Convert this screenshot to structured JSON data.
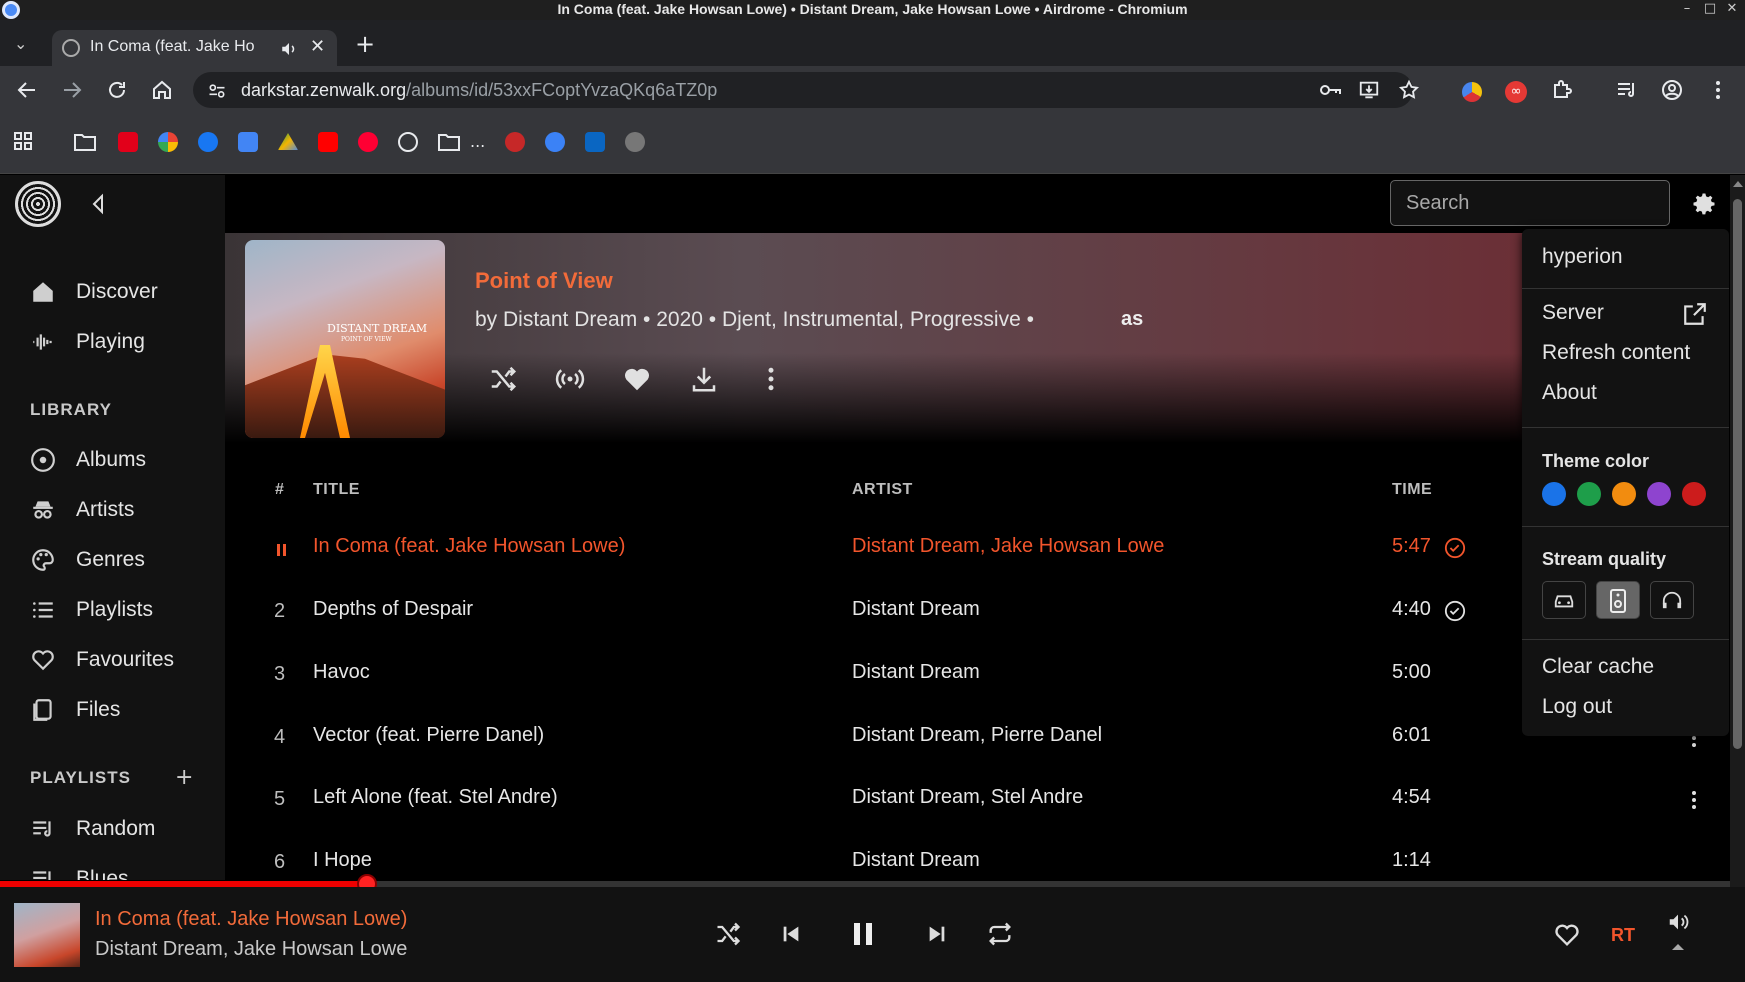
{
  "window": {
    "title": "In Coma (feat. Jake Howsan Lowe) • Distant Dream, Jake Howsan Lowe • Airdrome - Chromium"
  },
  "browser": {
    "tab_title": "In Coma (feat. Jake Ho",
    "url_host": "darkstar.zenwalk.org",
    "url_path": "/albums/id/53xxFCoptYvzaQKq6aTZ0p",
    "bookmarks_overflow": "..."
  },
  "app": {
    "search_placeholder": "Search",
    "nav": [
      {
        "label": "Discover",
        "icon": "home-icon"
      },
      {
        "label": "Playing",
        "icon": "waveform-icon"
      }
    ],
    "library_heading": "LIBRARY",
    "library": [
      {
        "label": "Albums",
        "icon": "disc-icon"
      },
      {
        "label": "Artists",
        "icon": "artist-icon"
      },
      {
        "label": "Genres",
        "icon": "palette-icon"
      },
      {
        "label": "Playlists",
        "icon": "list-icon"
      },
      {
        "label": "Favourites",
        "icon": "heart-icon"
      },
      {
        "label": "Files",
        "icon": "files-icon"
      }
    ],
    "playlists_heading": "PLAYLISTS",
    "playlists_add": "+",
    "playlists": [
      {
        "label": "Random"
      },
      {
        "label": "Blues"
      }
    ]
  },
  "album": {
    "title": "Point of View",
    "meta": "by Distant Dream  •  2020  •  Djent, Instrumental, Progressive  •",
    "cover_text": "DISTANT DREAM",
    "cover_subtext": "POINT OF VIEW"
  },
  "table": {
    "headers": {
      "num": "#",
      "title": "TITLE",
      "artist": "ARTIST",
      "time": "TIME"
    },
    "rows": [
      {
        "num": "",
        "title": "In Coma (feat. Jake Howsan Lowe)",
        "artist": "Distant Dream, Jake Howsan Lowe",
        "time": "5:47",
        "cached": true,
        "playing": true
      },
      {
        "num": "2",
        "title": "Depths of Despair",
        "artist": "Distant Dream",
        "time": "4:40",
        "cached": true
      },
      {
        "num": "3",
        "title": "Havoc",
        "artist": "Distant Dream",
        "time": "5:00"
      },
      {
        "num": "4",
        "title": "Vector (feat. Pierre Danel)",
        "artist": "Distant Dream, Pierre Danel",
        "time": "6:01"
      },
      {
        "num": "5",
        "title": "Left Alone (feat. Stel Andre)",
        "artist": "Distant Dream, Stel Andre",
        "time": "4:54"
      },
      {
        "num": "6",
        "title": "I Hope",
        "artist": "Distant Dream",
        "time": "1:14"
      }
    ]
  },
  "menu": {
    "user": "hyperion",
    "server": "Server",
    "refresh": "Refresh content",
    "about": "About",
    "theme_heading": "Theme color",
    "theme_colors": [
      "#1a73e8",
      "#1e9e4a",
      "#f28c0f",
      "#8e44cf",
      "#cc1c1c"
    ],
    "stream_heading": "Stream quality",
    "clear_cache": "Clear cache",
    "logout": "Log out"
  },
  "player": {
    "title": "In Coma (feat. Jake Howsan Lowe)",
    "artist": "Distant Dream, Jake Howsan Lowe",
    "progress_fraction": 0.212,
    "replaygain": "RT"
  },
  "colors": {
    "accent": "#f2552c",
    "progress": "#e00000"
  }
}
